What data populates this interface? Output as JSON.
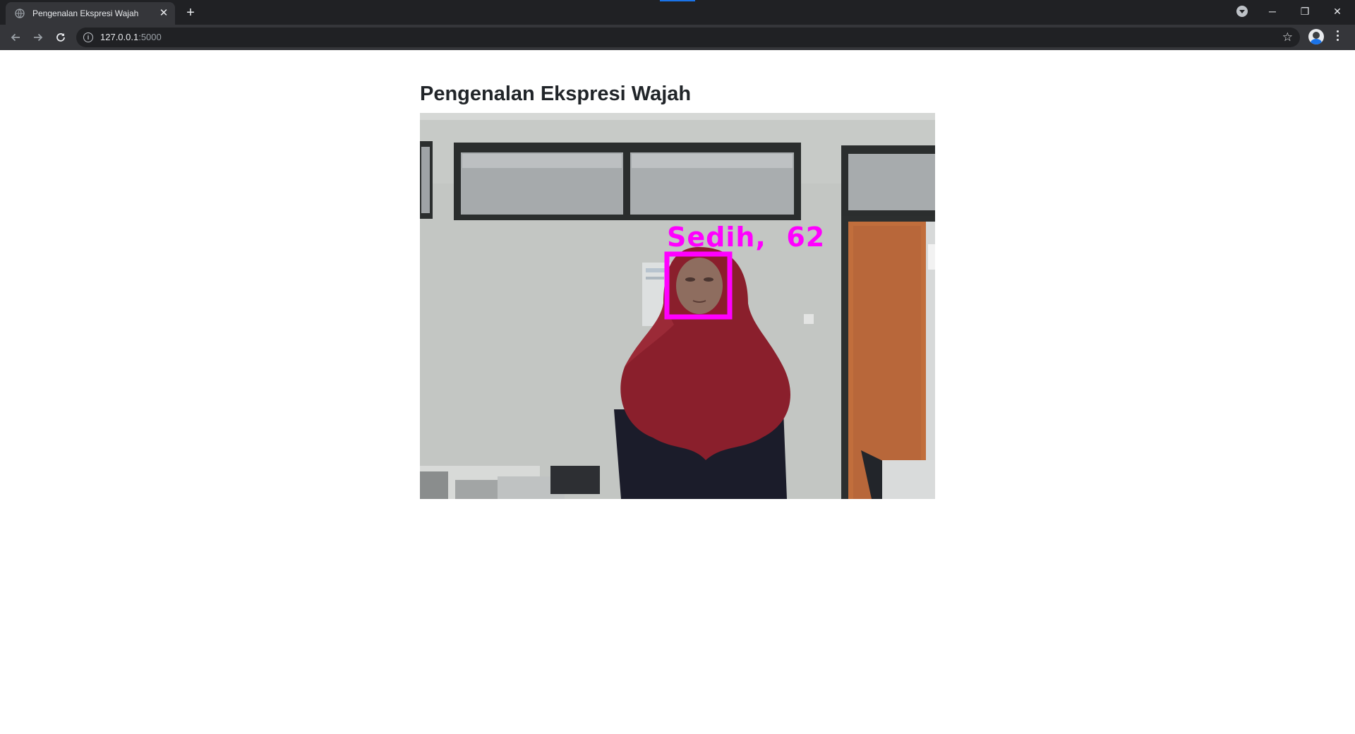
{
  "browser": {
    "tab_title": "Pengenalan Ekspresi Wajah",
    "url_host": "127.0.0.1",
    "url_port": ":5000",
    "accent_color": "#1a73e8",
    "icons": [
      "globe-icon",
      "close-icon",
      "plus-icon",
      "back-icon",
      "forward-icon",
      "reload-icon",
      "info-icon",
      "star-icon",
      "menu-icon"
    ]
  },
  "page": {
    "title": "Pengenalan Ekspresi Wajah"
  },
  "video": {
    "detection_label": "Sedih,  62",
    "detection_color": "#ff00ff"
  }
}
